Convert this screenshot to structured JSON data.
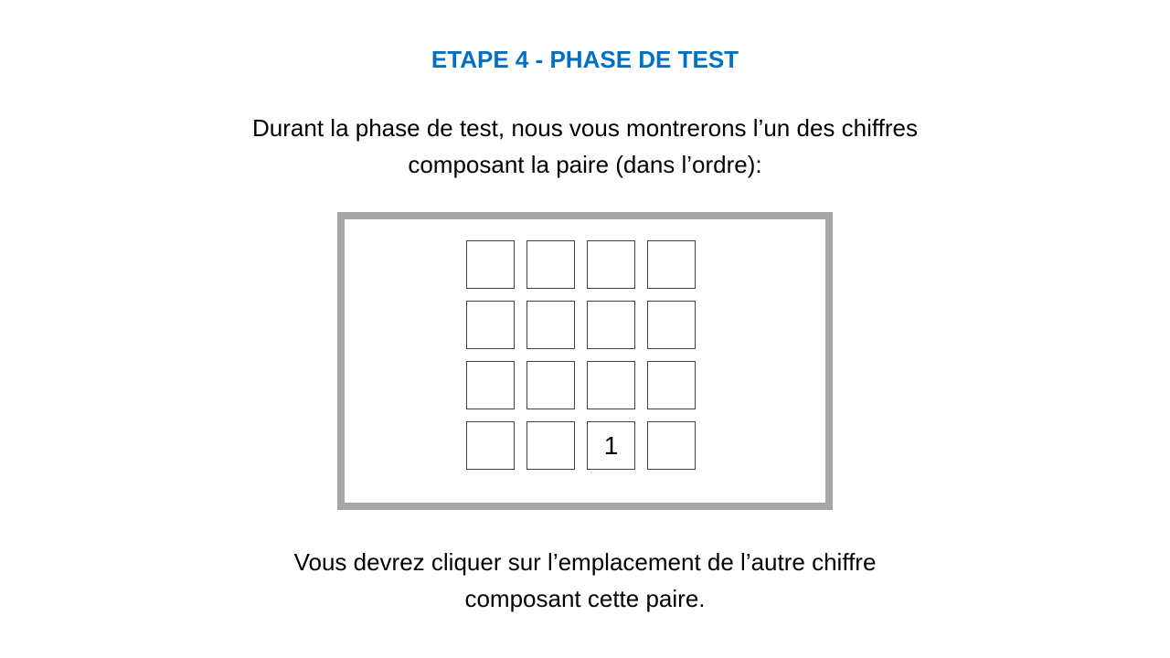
{
  "title": "ETAPE 4 - PHASE DE TEST",
  "intro": {
    "line1": "Durant la phase de test, nous vous montrerons l’un des chiffres",
    "line2": "composant la paire (dans l’ordre):"
  },
  "grid": {
    "cells": [
      [
        "",
        "",
        "",
        ""
      ],
      [
        "",
        "",
        "",
        ""
      ],
      [
        "",
        "",
        "",
        ""
      ],
      [
        "",
        "",
        "1",
        ""
      ]
    ]
  },
  "outro": {
    "line1": "Vous devrez cliquer sur l’emplacement de l’autre chiffre",
    "line2": "composant cette paire."
  },
  "colors": {
    "title": "#0070c0",
    "panel_border": "#a6a6a6",
    "cell_border": "#404040"
  }
}
